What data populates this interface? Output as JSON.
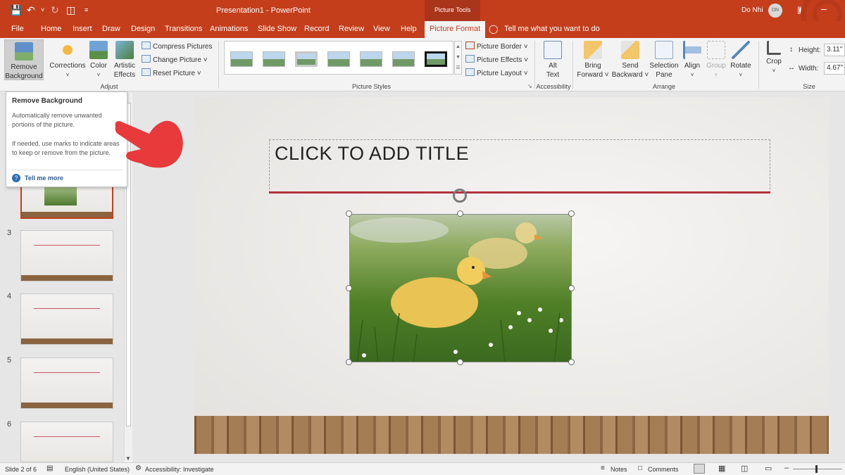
{
  "window": {
    "title": "Presentation1  -  PowerPoint",
    "contextual_group": "Picture Tools",
    "user_name": "Do Nhi",
    "user_initials": "DN"
  },
  "tabs": [
    "File",
    "Home",
    "Insert",
    "Draw",
    "Design",
    "Transitions",
    "Animations",
    "Slide Show",
    "Record",
    "Review",
    "View",
    "Help",
    "Picture Format"
  ],
  "tell_me": "Tell me what you want to do",
  "ribbon": {
    "adjust": {
      "label": "Adjust",
      "remove_background": [
        "Remove",
        "Background"
      ],
      "corrections": "Corrections",
      "color": "Color",
      "artistic_effects": [
        "Artistic",
        "Effects"
      ],
      "compress_pictures": "Compress Pictures",
      "change_picture": "Change Picture",
      "reset_picture": "Reset Picture"
    },
    "picture_styles": {
      "label": "Picture Styles",
      "picture_border": "Picture Border",
      "picture_effects": "Picture Effects",
      "picture_layout": "Picture Layout"
    },
    "accessibility": {
      "label": "Accessibility",
      "alt_text": [
        "Alt",
        "Text"
      ]
    },
    "arrange": {
      "label": "Arrange",
      "bring_forward": [
        "Bring",
        "Forward"
      ],
      "send_backward": [
        "Send",
        "Backward"
      ],
      "selection_pane": [
        "Selection",
        "Pane"
      ],
      "align": "Align",
      "group": "Group",
      "rotate": "Rotate"
    },
    "size": {
      "label": "Size",
      "crop": "Crop",
      "height_label": "Height:",
      "height_value": "3.11\"",
      "width_label": "Width:",
      "width_value": "4.67\""
    }
  },
  "tooltip": {
    "title": "Remove Background",
    "line1": "Automatically remove unwanted portions of the picture.",
    "line2": "If needed, use marks to indicate areas to keep or remove from the picture.",
    "link": "Tell me more"
  },
  "slides_panel": {
    "numbers": [
      "3",
      "4",
      "5",
      "6"
    ]
  },
  "slide": {
    "title_placeholder": "CLICK TO ADD TITLE"
  },
  "status": {
    "slide_info": "Slide 2 of 6",
    "language": "English (United States)",
    "accessibility": "Accessibility: Investigate",
    "notes": "Notes",
    "comments": "Comments"
  },
  "colors": {
    "accent": "#c43e1c",
    "ribbon_bg": "#f3f3f3",
    "pointer_hand": "#e8393b"
  }
}
